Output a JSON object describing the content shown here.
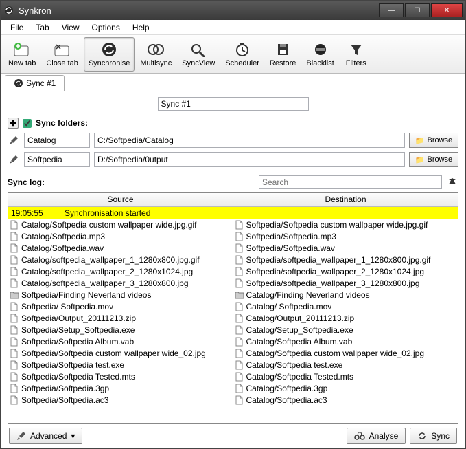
{
  "window": {
    "title": "Synkron"
  },
  "menu": {
    "file": "File",
    "tab": "Tab",
    "view": "View",
    "options": "Options",
    "help": "Help"
  },
  "toolbar": {
    "newtab": "New tab",
    "closetab": "Close tab",
    "synchronise": "Synchronise",
    "multisync": "Multisync",
    "syncview": "SyncView",
    "scheduler": "Scheduler",
    "restore": "Restore",
    "blacklist": "Blacklist",
    "filters": "Filters"
  },
  "tabs": {
    "tab1": "Sync #1"
  },
  "syncname": "Sync #1",
  "foldersLabel": "Sync folders:",
  "folder1": {
    "name": "Catalog",
    "path": "C:/Softpedia/Catalog"
  },
  "folder2": {
    "name": "Softpedia",
    "path": "D:/Softpedia/0utput"
  },
  "browse": "Browse",
  "synclogLabel": "Sync log:",
  "searchPlaceholder": "Search",
  "headers": {
    "source": "Source",
    "destination": "Destination"
  },
  "highlight": {
    "time": "19:05:55",
    "msg": "Synchronisation started"
  },
  "rows": [
    {
      "src": "Catalog/Softpedia custom wallpaper wide.jpg.gif",
      "dst": "Softpedia/Softpedia custom wallpaper wide.jpg.gif",
      "icon": "file"
    },
    {
      "src": "Catalog/Softpedia.mp3",
      "dst": "Softpedia/Softpedia.mp3",
      "icon": "file"
    },
    {
      "src": "Catalog/Softpedia.wav",
      "dst": "Softpedia/Softpedia.wav",
      "icon": "file"
    },
    {
      "src": "Catalog/softpedia_wallpaper_1_1280x800.jpg.gif",
      "dst": "Softpedia/softpedia_wallpaper_1_1280x800.jpg.gif",
      "icon": "file"
    },
    {
      "src": "Catalog/softpedia_wallpaper_2_1280x1024.jpg",
      "dst": "Softpedia/softpedia_wallpaper_2_1280x1024.jpg",
      "icon": "file"
    },
    {
      "src": "Catalog/softpedia_wallpaper_3_1280x800.jpg",
      "dst": "Softpedia/softpedia_wallpaper_3_1280x800.jpg",
      "icon": "file"
    },
    {
      "src": "Softpedia/Finding Neverland videos",
      "dst": "Catalog/Finding Neverland videos",
      "icon": "folder"
    },
    {
      "src": "Softpedia/ Softpedia.mov",
      "dst": "Catalog/ Softpedia.mov",
      "icon": "file"
    },
    {
      "src": "Softpedia/Output_20111213.zip",
      "dst": "Catalog/Output_20111213.zip",
      "icon": "file"
    },
    {
      "src": "Softpedia/Setup_Softpedia.exe",
      "dst": "Catalog/Setup_Softpedia.exe",
      "icon": "file"
    },
    {
      "src": "Softpedia/Softpedia Album.vab",
      "dst": "Catalog/Softpedia Album.vab",
      "icon": "file"
    },
    {
      "src": "Softpedia/Softpedia custom wallpaper wide_02.jpg",
      "dst": "Catalog/Softpedia custom wallpaper wide_02.jpg",
      "icon": "file"
    },
    {
      "src": "Softpedia/Softpedia test.exe",
      "dst": "Catalog/Softpedia test.exe",
      "icon": "file"
    },
    {
      "src": "Softpedia/Softpedia Tested.mts",
      "dst": "Catalog/Softpedia Tested.mts",
      "icon": "file"
    },
    {
      "src": "Softpedia/Softpedia.3gp",
      "dst": "Catalog/Softpedia.3gp",
      "icon": "file"
    },
    {
      "src": "Softpedia/Softpedia.ac3",
      "dst": "Catalog/Softpedia.ac3",
      "icon": "file"
    }
  ],
  "buttons": {
    "advanced": "Advanced",
    "analyse": "Analyse",
    "sync": "Sync"
  }
}
